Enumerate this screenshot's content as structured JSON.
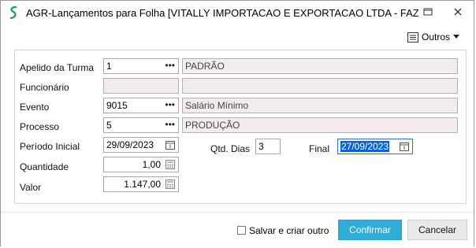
{
  "window": {
    "title": "AGR-Lançamentos para Folha [VITALLY IMPORTACAO E EXPORTACAO LTDA - FAZEN…"
  },
  "toolbar": {
    "outros_label": "Outros"
  },
  "form": {
    "apelido_turma": {
      "label": "Apelido da Turma",
      "code": "1",
      "description": "PADRÃO"
    },
    "funcionario": {
      "label": "Funcionário",
      "code": "",
      "description": ""
    },
    "evento": {
      "label": "Evento",
      "code": "9015",
      "description": "Salário Mínimo"
    },
    "processo": {
      "label": "Processo",
      "code": "5",
      "description": "PRODUÇÃO"
    },
    "periodo_inicial": {
      "label": "Período Inicial",
      "value": "29/09/2023"
    },
    "qtd_dias": {
      "label": "Qtd. Dias",
      "value": "3"
    },
    "final": {
      "label": "Final",
      "value": "27/09/2023"
    },
    "quantidade": {
      "label": "Quantidade",
      "value": "1,00"
    },
    "valor": {
      "label": "Valor",
      "value": "1.147,00"
    }
  },
  "footer": {
    "save_and_create_label": "Salvar e criar outro",
    "confirm_label": "Confirmar",
    "cancel_label": "Cancelar"
  },
  "colors": {
    "primary_button": "#2eaed6",
    "readonly_field": "#f3ecec",
    "selection": "#0a64d6",
    "brand_icon": "#1aa37a"
  }
}
